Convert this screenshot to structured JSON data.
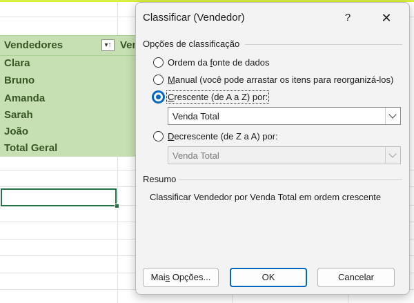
{
  "sheet": {
    "header_col1": "Vendedores",
    "header_col2": "Ven",
    "rows": [
      "Clara",
      "Bruno",
      "Amanda",
      "Sarah",
      "João",
      "Total Geral"
    ],
    "filter_icon": "sort-filter-icon"
  },
  "dialog": {
    "title": "Classificar (Vendedor)",
    "help_label": "?",
    "close_label": "✕",
    "options_label": "Opções de classificação",
    "radio_source": {
      "pre": "Ordem da ",
      "u": "f",
      "post": "onte de dados"
    },
    "radio_manual": {
      "pre": "",
      "u": "M",
      "post": "anual (você pode arrastar os itens para reorganizá-los)"
    },
    "radio_asc": {
      "pre": "",
      "u": "C",
      "post": "rescente (de A a Z) por:"
    },
    "radio_desc": {
      "pre": "",
      "u": "D",
      "post": "ecrescente (de Z a A) por:"
    },
    "asc_select_value": "Venda Total",
    "desc_select_value": "Venda Total",
    "summary_label": "Resumo",
    "summary_text": "Classificar Vendedor por Venda Total em ordem crescente",
    "more_options": {
      "pre": "Mai",
      "u": "s",
      "post": " Opções..."
    },
    "ok_label": "OK",
    "cancel_label": "Cancelar",
    "accent_color": "#0067c0",
    "pivot_fill": "#c6e0b4",
    "pivot_text": "#375623"
  }
}
